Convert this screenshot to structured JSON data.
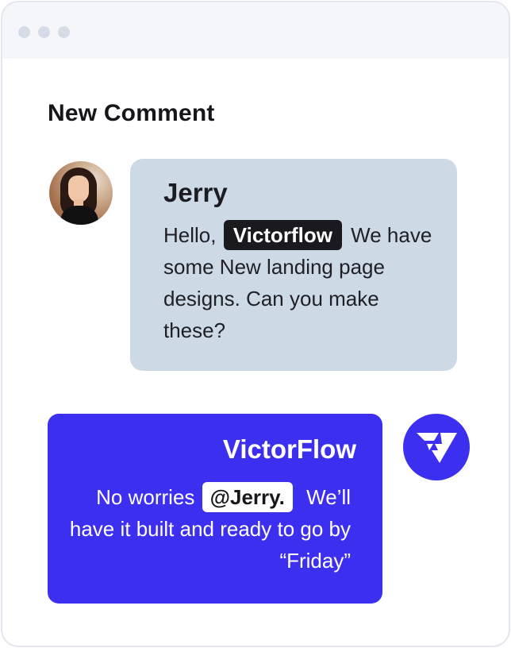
{
  "window": {
    "controls": [
      "close",
      "minimize",
      "maximize"
    ]
  },
  "heading": "New Comment",
  "incoming": {
    "avatar": "user-avatar-photo",
    "name": "Jerry",
    "text_before": "Hello,",
    "mention": "Victorflow",
    "text_after": "We have some New landing page designs. Can you make these?"
  },
  "outgoing": {
    "logo": "victorflow-logo",
    "name": "VictorFlow",
    "text_before": "No worries",
    "mention": "@Jerry.",
    "text_after": "We’ll have it built and ready to go by “Friday”"
  },
  "colors": {
    "incoming_bubble": "#cdd9e5",
    "outgoing_bubble": "#3d2ff0",
    "window_border": "#e3e6ee",
    "titlebar": "#f4f6f9"
  }
}
